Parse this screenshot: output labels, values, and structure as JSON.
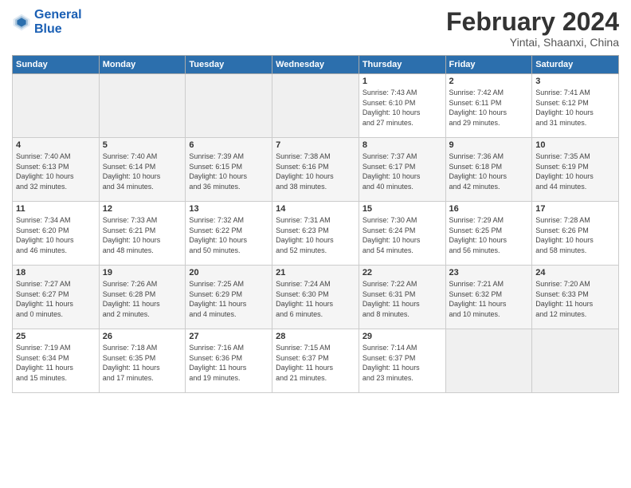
{
  "header": {
    "logo_line1": "General",
    "logo_line2": "Blue",
    "title": "February 2024",
    "subtitle": "Yintai, Shaanxi, China"
  },
  "weekdays": [
    "Sunday",
    "Monday",
    "Tuesday",
    "Wednesday",
    "Thursday",
    "Friday",
    "Saturday"
  ],
  "weeks": [
    [
      {
        "day": "",
        "info": ""
      },
      {
        "day": "",
        "info": ""
      },
      {
        "day": "",
        "info": ""
      },
      {
        "day": "",
        "info": ""
      },
      {
        "day": "1",
        "info": "Sunrise: 7:43 AM\nSunset: 6:10 PM\nDaylight: 10 hours\nand 27 minutes."
      },
      {
        "day": "2",
        "info": "Sunrise: 7:42 AM\nSunset: 6:11 PM\nDaylight: 10 hours\nand 29 minutes."
      },
      {
        "day": "3",
        "info": "Sunrise: 7:41 AM\nSunset: 6:12 PM\nDaylight: 10 hours\nand 31 minutes."
      }
    ],
    [
      {
        "day": "4",
        "info": "Sunrise: 7:40 AM\nSunset: 6:13 PM\nDaylight: 10 hours\nand 32 minutes."
      },
      {
        "day": "5",
        "info": "Sunrise: 7:40 AM\nSunset: 6:14 PM\nDaylight: 10 hours\nand 34 minutes."
      },
      {
        "day": "6",
        "info": "Sunrise: 7:39 AM\nSunset: 6:15 PM\nDaylight: 10 hours\nand 36 minutes."
      },
      {
        "day": "7",
        "info": "Sunrise: 7:38 AM\nSunset: 6:16 PM\nDaylight: 10 hours\nand 38 minutes."
      },
      {
        "day": "8",
        "info": "Sunrise: 7:37 AM\nSunset: 6:17 PM\nDaylight: 10 hours\nand 40 minutes."
      },
      {
        "day": "9",
        "info": "Sunrise: 7:36 AM\nSunset: 6:18 PM\nDaylight: 10 hours\nand 42 minutes."
      },
      {
        "day": "10",
        "info": "Sunrise: 7:35 AM\nSunset: 6:19 PM\nDaylight: 10 hours\nand 44 minutes."
      }
    ],
    [
      {
        "day": "11",
        "info": "Sunrise: 7:34 AM\nSunset: 6:20 PM\nDaylight: 10 hours\nand 46 minutes."
      },
      {
        "day": "12",
        "info": "Sunrise: 7:33 AM\nSunset: 6:21 PM\nDaylight: 10 hours\nand 48 minutes."
      },
      {
        "day": "13",
        "info": "Sunrise: 7:32 AM\nSunset: 6:22 PM\nDaylight: 10 hours\nand 50 minutes."
      },
      {
        "day": "14",
        "info": "Sunrise: 7:31 AM\nSunset: 6:23 PM\nDaylight: 10 hours\nand 52 minutes."
      },
      {
        "day": "15",
        "info": "Sunrise: 7:30 AM\nSunset: 6:24 PM\nDaylight: 10 hours\nand 54 minutes."
      },
      {
        "day": "16",
        "info": "Sunrise: 7:29 AM\nSunset: 6:25 PM\nDaylight: 10 hours\nand 56 minutes."
      },
      {
        "day": "17",
        "info": "Sunrise: 7:28 AM\nSunset: 6:26 PM\nDaylight: 10 hours\nand 58 minutes."
      }
    ],
    [
      {
        "day": "18",
        "info": "Sunrise: 7:27 AM\nSunset: 6:27 PM\nDaylight: 11 hours\nand 0 minutes."
      },
      {
        "day": "19",
        "info": "Sunrise: 7:26 AM\nSunset: 6:28 PM\nDaylight: 11 hours\nand 2 minutes."
      },
      {
        "day": "20",
        "info": "Sunrise: 7:25 AM\nSunset: 6:29 PM\nDaylight: 11 hours\nand 4 minutes."
      },
      {
        "day": "21",
        "info": "Sunrise: 7:24 AM\nSunset: 6:30 PM\nDaylight: 11 hours\nand 6 minutes."
      },
      {
        "day": "22",
        "info": "Sunrise: 7:22 AM\nSunset: 6:31 PM\nDaylight: 11 hours\nand 8 minutes."
      },
      {
        "day": "23",
        "info": "Sunrise: 7:21 AM\nSunset: 6:32 PM\nDaylight: 11 hours\nand 10 minutes."
      },
      {
        "day": "24",
        "info": "Sunrise: 7:20 AM\nSunset: 6:33 PM\nDaylight: 11 hours\nand 12 minutes."
      }
    ],
    [
      {
        "day": "25",
        "info": "Sunrise: 7:19 AM\nSunset: 6:34 PM\nDaylight: 11 hours\nand 15 minutes."
      },
      {
        "day": "26",
        "info": "Sunrise: 7:18 AM\nSunset: 6:35 PM\nDaylight: 11 hours\nand 17 minutes."
      },
      {
        "day": "27",
        "info": "Sunrise: 7:16 AM\nSunset: 6:36 PM\nDaylight: 11 hours\nand 19 minutes."
      },
      {
        "day": "28",
        "info": "Sunrise: 7:15 AM\nSunset: 6:37 PM\nDaylight: 11 hours\nand 21 minutes."
      },
      {
        "day": "29",
        "info": "Sunrise: 7:14 AM\nSunset: 6:37 PM\nDaylight: 11 hours\nand 23 minutes."
      },
      {
        "day": "",
        "info": ""
      },
      {
        "day": "",
        "info": ""
      }
    ]
  ]
}
